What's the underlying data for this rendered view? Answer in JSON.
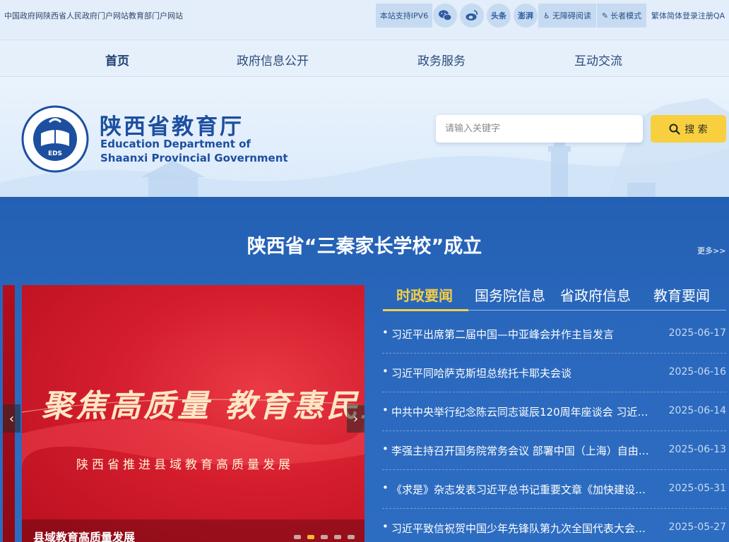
{
  "topbar": {
    "links": [
      "中国政府网",
      "陕西省人民政府门户网站",
      "教育部门户网站"
    ],
    "ipv6": "本站支持IPV6",
    "social": [
      "wechat-icon",
      "weibo-icon",
      "头条",
      "澎湃"
    ],
    "accessibility": "无障碍阅读",
    "elder_mode": "长者模式",
    "lang": [
      "繁体",
      "简体",
      "登录",
      "注册",
      "QA"
    ]
  },
  "nav": {
    "items": [
      "首页",
      "政府信息公开",
      "政务服务",
      "互动交流"
    ]
  },
  "logo": {
    "emblem_text": "EDS",
    "cn": "陕西省教育厅",
    "en_line1": "Education Department of",
    "en_line2": "Shaanxi Provincial Government"
  },
  "search": {
    "placeholder": "请输入关键字",
    "button": "搜 索"
  },
  "headline": {
    "title": "陕西省“三秦家长学校”成立",
    "more": "更多>>"
  },
  "slider": {
    "calligraphy": "聚焦高质量 教育惠民生",
    "subtitle": "陕西省推进县域教育高质量发展",
    "caption": "县域教育高质量发展",
    "dot_count": 5,
    "active_dot": 1
  },
  "news": {
    "tabs": [
      "时政要闻",
      "国务院信息",
      "省政府信息",
      "教育要闻"
    ],
    "active_tab": 0,
    "items": [
      {
        "title": "习近平出席第二届中国—中亚峰会并作主旨发言",
        "date": "2025-06-17"
      },
      {
        "title": "习近平同哈萨克斯坦总统托卡耶夫会谈",
        "date": "2025-06-16"
      },
      {
        "title": "中共中央举行纪念陈云同志诞辰120周年座谈会 习近…",
        "date": "2025-06-14"
      },
      {
        "title": "李强主持召开国务院常务会议 部署中国（上海）自由…",
        "date": "2025-06-13"
      },
      {
        "title": "《求是》杂志发表习近平总书记重要文章《加快建设…",
        "date": "2025-05-31"
      },
      {
        "title": "习近平致信祝贺中国少年先锋队第九次全国代表大会…",
        "date": "2025-05-27"
      }
    ]
  }
}
